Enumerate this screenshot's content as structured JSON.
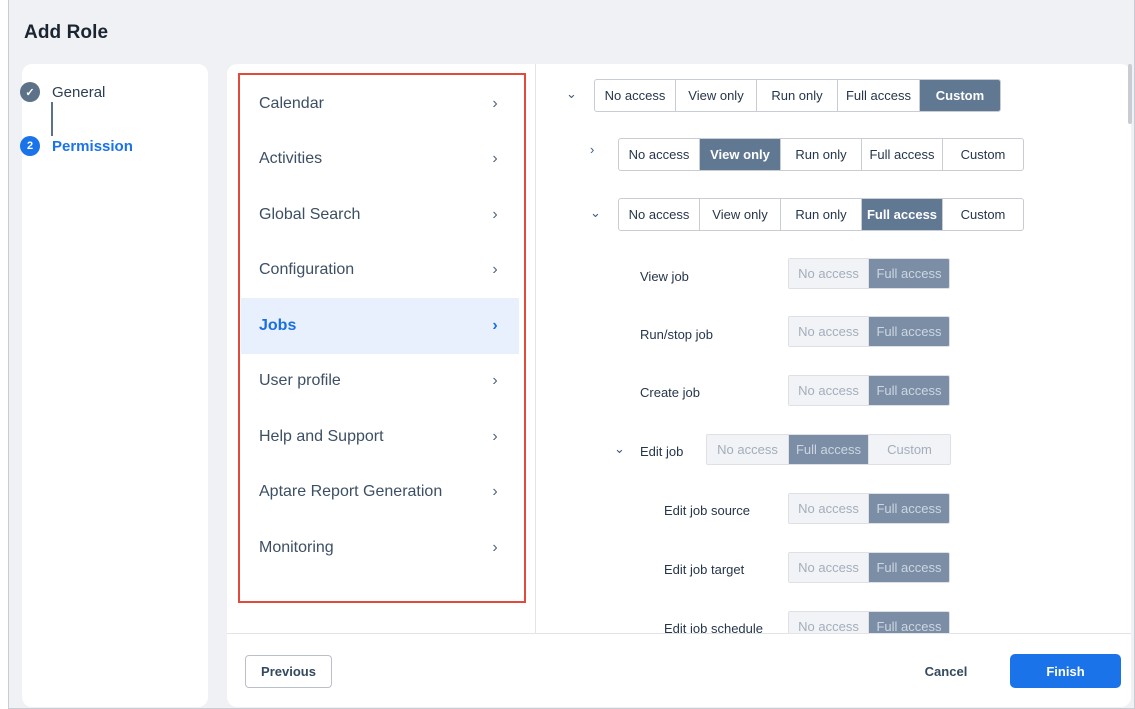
{
  "dialog": {
    "title": "Add Role"
  },
  "steps": [
    {
      "label": "General",
      "status": "done",
      "marker": "✓"
    },
    {
      "label": "Permission",
      "status": "active",
      "marker": "2"
    }
  ],
  "categories": [
    {
      "label": "Calendar"
    },
    {
      "label": "Activities"
    },
    {
      "label": "Global Search"
    },
    {
      "label": "Configuration"
    },
    {
      "label": "Jobs",
      "active": true
    },
    {
      "label": "User profile"
    },
    {
      "label": "Help and Support"
    },
    {
      "label": "Aptare Report Generation"
    },
    {
      "label": "Monitoring"
    }
  ],
  "access_levels": {
    "no_access": "No access",
    "view_only": "View only",
    "run_only": "Run only",
    "full_access": "Full access",
    "custom": "Custom"
  },
  "permission_groups": [
    {
      "expanded": true,
      "selected": "Custom"
    },
    {
      "expanded": false,
      "selected": "View only"
    },
    {
      "expanded": true,
      "selected": "Full access"
    }
  ],
  "job_permissions": [
    {
      "label": "View job",
      "selected": "Full access"
    },
    {
      "label": "Run/stop job",
      "selected": "Full access"
    },
    {
      "label": "Create job",
      "selected": "Full access"
    },
    {
      "label": "Edit job",
      "selected": "Full access",
      "expandable": true
    },
    {
      "label": "Edit job source",
      "selected": "Full access"
    },
    {
      "label": "Edit job target",
      "selected": "Full access"
    },
    {
      "label": "Edit job schedule",
      "selected": "Full access"
    }
  ],
  "footer": {
    "previous_label": "Previous",
    "cancel_label": "Cancel",
    "finish_label": "Finish"
  },
  "icons": {
    "chevron_right": "›",
    "chevron_down": "⌄"
  },
  "colors": {
    "accent": "#1a73e8",
    "selected_segment": "#617893",
    "highlight_box": "#e24a3a"
  }
}
